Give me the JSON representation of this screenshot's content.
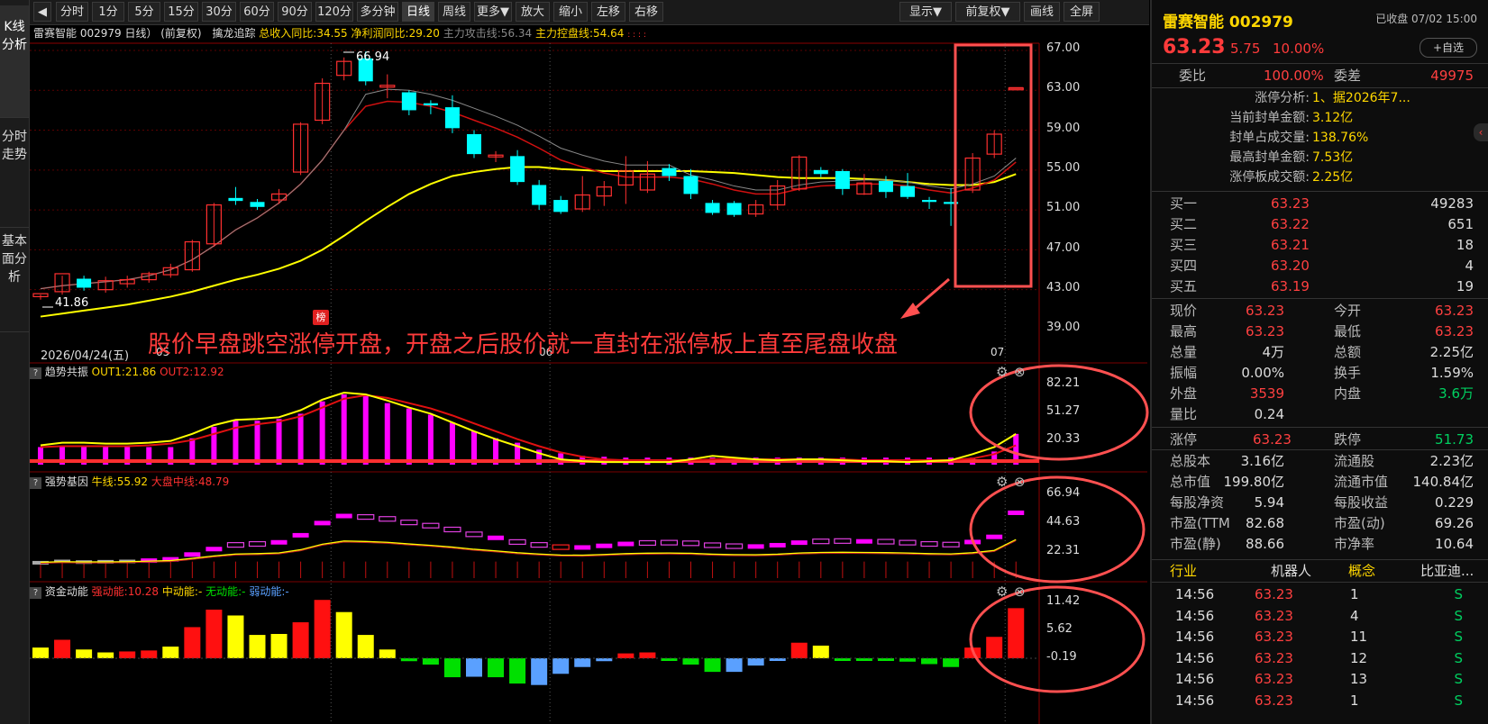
{
  "left_tabs": [
    "K线分析",
    "分时走势",
    "基本面分析"
  ],
  "toolbar": {
    "buttons": [
      "分时",
      "1分",
      "5分",
      "15分",
      "30分",
      "60分",
      "90分",
      "120分",
      "多分钟",
      "日线",
      "周线",
      "更多▼",
      "放大",
      "缩小",
      "左移",
      "右移"
    ],
    "right_buttons": [
      "显示▼",
      "前复权▼",
      "画线",
      "全屏"
    ]
  },
  "main_chart": {
    "header_name": "雷赛智能 002979 日线） (前复权)",
    "indicator_name": "擒龙追踪",
    "revenue_label": "总收入同比:34.55",
    "profit_label": "净利润同比:29.20",
    "attack_label": "主力攻击线:56.34",
    "control_label": "主力控盘线:54.64",
    "y_ticks": [
      "67.00",
      "63.00",
      "59.00",
      "55.00",
      "51.00",
      "47.00",
      "43.00",
      "39.00"
    ],
    "high_label": "66.94",
    "low_label": "41.86",
    "date_label": "2026/04/24(五)",
    "x_ticks": [
      "05",
      "06",
      "07"
    ],
    "bang_label": "榜",
    "annotation": "股价早盘跳空涨停开盘，开盘之后股价就一直封在涨停板上直至尾盘收盘"
  },
  "panel1": {
    "name": "趋势共振",
    "out1": "OUT1:21.86",
    "out2": "OUT2:12.92",
    "y_ticks": [
      "82.21",
      "51.27",
      "20.33"
    ]
  },
  "panel2": {
    "name": "强势基因",
    "bull": "牛线:55.92",
    "market": "大盘中线:48.79",
    "y_ticks": [
      "66.94",
      "44.63",
      "22.31"
    ]
  },
  "panel3": {
    "name": "资金动能",
    "strong": "强动能:10.28",
    "mid": "中动能:-",
    "none": "无动能:-",
    "weak": "弱动能:-",
    "y_ticks": [
      "11.42",
      "5.62",
      "-0.19"
    ]
  },
  "quote": {
    "name": "雷赛智能 002979",
    "status": "已收盘 07/02 15:00",
    "price": "63.23",
    "change": "5.75",
    "pct": "10.00%",
    "add_btn": "+自选",
    "weibi_label": "委比",
    "weibi": "100.00%",
    "weicha_label": "委差",
    "weicha": "49975",
    "limit_analysis": [
      {
        "label": "涨停分析:",
        "value": "1、据2026年7..."
      },
      {
        "label": "当前封单金额:",
        "value": "3.12亿"
      },
      {
        "label": "封单占成交量:",
        "value": "138.76%"
      },
      {
        "label": "最高封单金额:",
        "value": "7.53亿"
      },
      {
        "label": "涨停板成交额:",
        "value": "2.25亿"
      }
    ],
    "bids": [
      {
        "label": "买一",
        "price": "63.23",
        "vol": "49283"
      },
      {
        "label": "买二",
        "price": "63.22",
        "vol": "651"
      },
      {
        "label": "买三",
        "price": "63.21",
        "vol": "18"
      },
      {
        "label": "买四",
        "price": "63.20",
        "vol": "4"
      },
      {
        "label": "买五",
        "price": "63.19",
        "vol": "19"
      }
    ],
    "stats": [
      {
        "l1": "现价",
        "v1": "63.23",
        "c1": "red",
        "l2": "今开",
        "v2": "63.23",
        "c2": "red"
      },
      {
        "l1": "最高",
        "v1": "63.23",
        "c1": "red",
        "l2": "最低",
        "v2": "63.23",
        "c2": "red"
      },
      {
        "l1": "总量",
        "v1": "4万",
        "c1": "white",
        "l2": "总额",
        "v2": "2.25亿",
        "c2": "white"
      },
      {
        "l1": "振幅",
        "v1": "0.00%",
        "c1": "white",
        "l2": "换手",
        "v2": "1.59%",
        "c2": "white"
      },
      {
        "l1": "外盘",
        "v1": "3539",
        "c1": "red",
        "l2": "内盘",
        "v2": "3.6万",
        "c2": "green"
      },
      {
        "l1": "量比",
        "v1": "0.24",
        "c1": "white",
        "l2": "",
        "v2": "",
        "c2": "white"
      }
    ],
    "limits": {
      "up_label": "涨停",
      "up": "63.23",
      "down_label": "跌停",
      "down": "51.73"
    },
    "fundamentals": [
      {
        "l1": "总股本",
        "v1": "3.16亿",
        "l2": "流通股",
        "v2": "2.23亿"
      },
      {
        "l1": "总市值",
        "v1": "199.80亿",
        "l2": "流通市值",
        "v2": "140.84亿"
      },
      {
        "l1": "每股净资",
        "v1": "5.94",
        "l2": "每股收益",
        "v2": "0.229"
      },
      {
        "l1": "市盈(TTM",
        "v1": "82.68",
        "l2": "市盈(动)",
        "v2": "69.26"
      },
      {
        "l1": "市盈(静)",
        "v1": "88.66",
        "l2": "市净率",
        "v2": "10.64"
      }
    ],
    "sector": {
      "industry_label": "行业",
      "industry": "机器人",
      "concept_label": "概念",
      "concept": "比亚迪..."
    },
    "ticks": [
      {
        "time": "14:56",
        "price": "63.23",
        "vol": "1",
        "side": "S"
      },
      {
        "time": "14:56",
        "price": "63.23",
        "vol": "4",
        "side": "S"
      },
      {
        "time": "14:56",
        "price": "63.23",
        "vol": "11",
        "side": "S"
      },
      {
        "time": "14:56",
        "price": "63.23",
        "vol": "12",
        "side": "S"
      },
      {
        "time": "14:56",
        "price": "63.23",
        "vol": "13",
        "side": "S"
      },
      {
        "time": "14:56",
        "price": "63.23",
        "vol": "1",
        "side": "S"
      }
    ]
  },
  "candles": [
    [
      42.3,
      42.6,
      42.0,
      42.5
    ],
    [
      42.8,
      44.6,
      42.5,
      44.4
    ],
    [
      44.1,
      43.2,
      42.9,
      44.4
    ],
    [
      43.0,
      43.9,
      42.7,
      44.3
    ],
    [
      43.6,
      44.0,
      43.2,
      44.4
    ],
    [
      44.0,
      44.6,
      43.7,
      44.8
    ],
    [
      44.5,
      45.2,
      44.2,
      45.6
    ],
    [
      45.0,
      47.8,
      44.8,
      48.0
    ],
    [
      47.6,
      51.5,
      47.3,
      51.7
    ],
    [
      52.2,
      51.9,
      51.5,
      53.3
    ],
    [
      51.8,
      51.3,
      51.0,
      52.1
    ],
    [
      52.0,
      52.6,
      51.6,
      53.1
    ],
    [
      54.8,
      59.6,
      54.5,
      59.8
    ],
    [
      60.0,
      63.7,
      59.6,
      64.2
    ],
    [
      64.5,
      65.9,
      64.0,
      66.3
    ],
    [
      66.2,
      63.9,
      63.5,
      66.9
    ],
    [
      63.5,
      63.5,
      62.2,
      64.6
    ],
    [
      62.8,
      61.0,
      60.5,
      63.0
    ],
    [
      61.7,
      61.5,
      60.6,
      62.0
    ],
    [
      61.3,
      59.2,
      58.7,
      62.5
    ],
    [
      58.6,
      56.6,
      56.2,
      59.0
    ],
    [
      56.4,
      56.5,
      55.8,
      56.9
    ],
    [
      56.4,
      53.8,
      53.5,
      57.0
    ],
    [
      53.5,
      51.5,
      51.0,
      54.0
    ],
    [
      52.0,
      50.8,
      50.6,
      52.4
    ],
    [
      51.1,
      52.5,
      50.8,
      54.4
    ],
    [
      52.4,
      53.3,
      51.4,
      53.9
    ],
    [
      53.5,
      54.9,
      51.6,
      56.4
    ],
    [
      53.0,
      54.6,
      52.7,
      55.9
    ],
    [
      55.2,
      54.4,
      53.9,
      55.6
    ],
    [
      54.4,
      52.6,
      52.1,
      55.1
    ],
    [
      51.7,
      50.7,
      50.5,
      52.0
    ],
    [
      51.7,
      50.5,
      50.3,
      51.9
    ],
    [
      50.6,
      51.5,
      50.3,
      52.0
    ],
    [
      51.5,
      53.4,
      51.0,
      54.0
    ],
    [
      53.1,
      56.3,
      52.9,
      56.5
    ],
    [
      55.0,
      54.6,
      54.3,
      55.3
    ],
    [
      54.9,
      53.1,
      52.5,
      55.1
    ],
    [
      52.6,
      53.7,
      52.5,
      54.6
    ],
    [
      53.9,
      52.8,
      52.2,
      54.4
    ],
    [
      53.4,
      52.3,
      52.1,
      54.7
    ],
    [
      52.0,
      51.8,
      51.1,
      52.3
    ],
    [
      51.8,
      51.6,
      49.4,
      53.2
    ],
    [
      53.0,
      56.2,
      52.7,
      56.7
    ],
    [
      56.6,
      58.6,
      56.2,
      59.0
    ],
    [
      63.23,
      63.23,
      63.23,
      63.23
    ]
  ],
  "ma_short": [
    43.1,
    43.4,
    43.6,
    43.8,
    44.0,
    44.4,
    45.0,
    46.0,
    47.4,
    49.0,
    50.2,
    51.7,
    53.6,
    56.0,
    59.0,
    61.4,
    61.9,
    61.8,
    61.4,
    60.8,
    60.0,
    59.2,
    58.3,
    57.2,
    56.0,
    55.3,
    54.7,
    54.3,
    54.3,
    54.3,
    54.1,
    53.6,
    53.0,
    52.6,
    52.6,
    53.1,
    53.4,
    53.5,
    53.6,
    53.6,
    53.4,
    53.0,
    52.7,
    53.2,
    54.0,
    55.8
  ],
  "ma_long": [
    40.3,
    40.6,
    40.9,
    41.2,
    41.5,
    41.9,
    42.3,
    42.8,
    43.4,
    44.0,
    44.5,
    45.1,
    45.9,
    47.0,
    48.4,
    49.9,
    51.3,
    52.6,
    53.6,
    54.4,
    54.8,
    55.1,
    55.3,
    55.3,
    55.1,
    55.0,
    54.9,
    54.9,
    54.9,
    54.9,
    54.9,
    54.8,
    54.7,
    54.5,
    54.3,
    54.2,
    54.2,
    54.2,
    54.1,
    54.0,
    53.8,
    53.6,
    53.5,
    53.5,
    53.8,
    54.6
  ],
  "trend_bars": [
    20,
    20,
    20,
    20,
    20,
    20,
    20,
    30,
    43,
    50,
    50,
    52,
    58,
    72,
    80,
    78,
    70,
    64,
    57,
    48,
    38,
    30,
    25,
    17,
    13,
    10,
    9,
    8,
    8,
    8,
    8,
    8,
    8,
    8,
    8,
    8,
    8,
    8,
    8,
    8,
    8,
    8,
    8,
    8,
    15,
    35
  ],
  "trend_line1": [
    22,
    25,
    25,
    24,
    24,
    25,
    27,
    35,
    45,
    51,
    52,
    54,
    62,
    74,
    82,
    80,
    73,
    65,
    58,
    48,
    38,
    29,
    21,
    13,
    6,
    4,
    3,
    3,
    3,
    3,
    6,
    10,
    8,
    6,
    5,
    6,
    6,
    5,
    4,
    4,
    3,
    4,
    5,
    12,
    20,
    35
  ],
  "trend_line2": [
    20,
    21,
    21,
    21,
    21,
    22,
    24,
    28,
    35,
    42,
    46,
    49,
    55,
    65,
    75,
    79,
    76,
    70,
    64,
    56,
    47,
    38,
    29,
    21,
    14,
    9,
    6,
    5,
    5,
    5,
    5,
    6,
    7,
    6,
    6,
    6,
    6,
    6,
    5,
    5,
    5,
    5,
    5,
    7,
    12,
    22
  ],
  "gene_body": [
    44.8,
    45.2,
    45.0,
    45.1,
    45.2,
    45.6,
    46.0,
    47.5,
    49.2,
    50.5,
    50.8,
    51.3,
    53.5,
    57.3,
    59.5,
    59.2,
    58.6,
    57.5,
    56.5,
    55.3,
    53.8,
    52.7,
    51.4,
    50.5,
    49.8,
    49.7,
    50.2,
    50.8,
    51.1,
    51.2,
    51.0,
    50.4,
    50.1,
    50.0,
    50.4,
    51.2,
    51.6,
    51.7,
    51.6,
    51.5,
    51.2,
    50.8,
    50.6,
    51.4,
    53.0,
    60.5
  ],
  "gene_up": [
    1,
    1,
    0,
    1,
    1,
    1,
    1,
    1,
    1,
    0,
    0,
    1,
    1,
    1,
    1,
    0,
    0,
    0,
    0,
    0,
    0,
    1,
    0,
    0,
    0,
    1,
    1,
    1,
    0,
    0,
    0,
    0,
    0,
    1,
    1,
    1,
    0,
    0,
    1,
    0,
    0,
    0,
    0,
    1,
    1,
    1
  ],
  "fund_bars": [
    2.2,
    3.8,
    1.8,
    1.2,
    1.4,
    1.6,
    2.4,
    6.4,
    10.0,
    8.8,
    4.8,
    5.0,
    7.4,
    12.0,
    9.5,
    4.8,
    1.8,
    -0.6,
    -1.3,
    -3.9,
    -3.8,
    -3.9,
    -5.2,
    -5.5,
    -3.2,
    -1.8,
    -0.6,
    1.0,
    1.2,
    -0.4,
    -1.3,
    -2.8,
    -2.8,
    -1.5,
    -0.1,
    3.2,
    2.6,
    -0.2,
    -0.2,
    -0.2,
    -0.7,
    -1.2,
    -1.8,
    2.2,
    4.4,
    10.3
  ],
  "fund_colors": [
    "y",
    "r",
    "y",
    "y",
    "r",
    "r",
    "y",
    "r",
    "r",
    "y",
    "y",
    "y",
    "r",
    "r",
    "y",
    "y",
    "y",
    "g",
    "g",
    "g",
    "b",
    "g",
    "g",
    "b",
    "b",
    "b",
    "b",
    "r",
    "r",
    "g",
    "g",
    "g",
    "b",
    "b",
    "b",
    "r",
    "y",
    "g",
    "g",
    "g",
    "g",
    "g",
    "g",
    "r",
    "r",
    "r"
  ]
}
